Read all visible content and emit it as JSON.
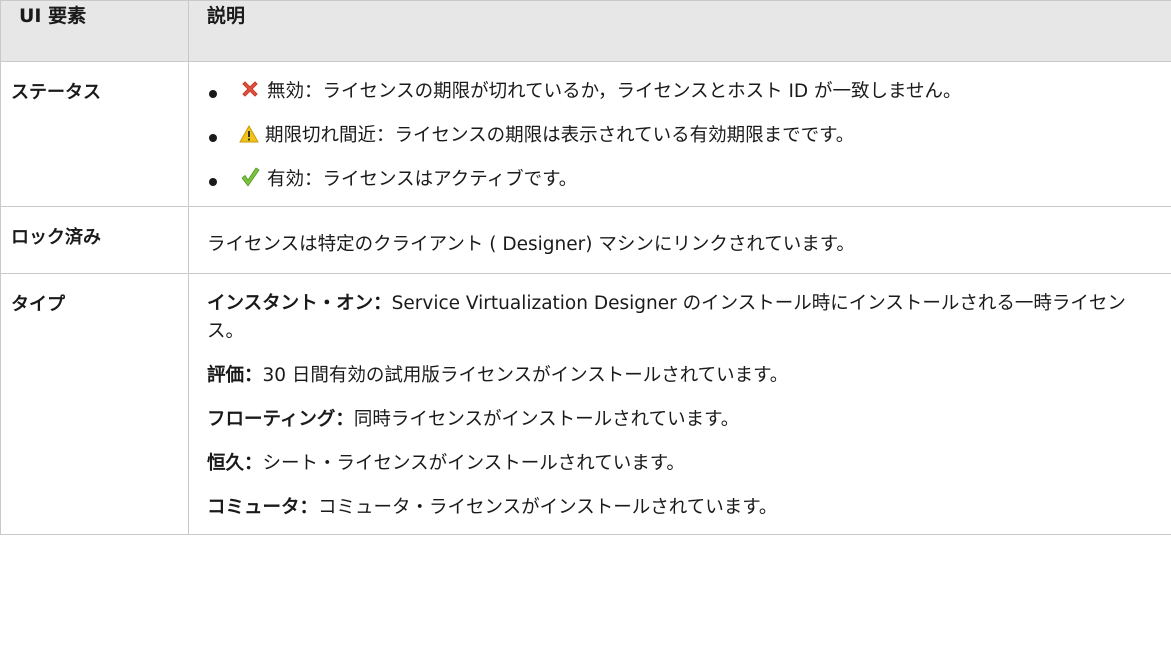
{
  "table": {
    "headers": [
      "UI 要素",
      "説明"
    ],
    "rows": {
      "status": {
        "name": "ステータス",
        "items": [
          {
            "icon": "x-mark-icon",
            "text": "無効：ライセンスの期限が切れているか，ライセンスとホスト ID が一致しません。"
          },
          {
            "icon": "warning-triangle-icon",
            "text": "期限切れ間近：ライセンスの期限は表示されている有効期限までです。"
          },
          {
            "icon": "checkmark-icon",
            "text": "有効：ライセンスはアクティブです。"
          }
        ]
      },
      "locked": {
        "name": "ロック済み",
        "text": "ライセンスは特定のクライアント ( Designer) マシンにリンクされています。"
      },
      "type": {
        "name": "タイプ",
        "items": [
          {
            "term": "インスタント・オン：",
            "text": "Service Virtualization Designer のインストール時にインストールされる一時ライセンス。"
          },
          {
            "term": "評価：",
            "text": "30 日間有効の試用版ライセンスがインストールされています。"
          },
          {
            "term": "フローティング：",
            "text": "同時ライセンスがインストールされています。"
          },
          {
            "term": "恒久：",
            "text": "シート・ライセンスがインストールされています。"
          },
          {
            "term": "コミュータ：",
            "text": "コミュータ・ライセンスがインストールされています。"
          }
        ]
      }
    }
  },
  "colors": {
    "header_bg": "#e7e7e7",
    "border": "#c9c9c9",
    "invalid_icon": "#e8513d",
    "warning_icon": "#f0c419",
    "valid_icon": "#7cc142"
  }
}
